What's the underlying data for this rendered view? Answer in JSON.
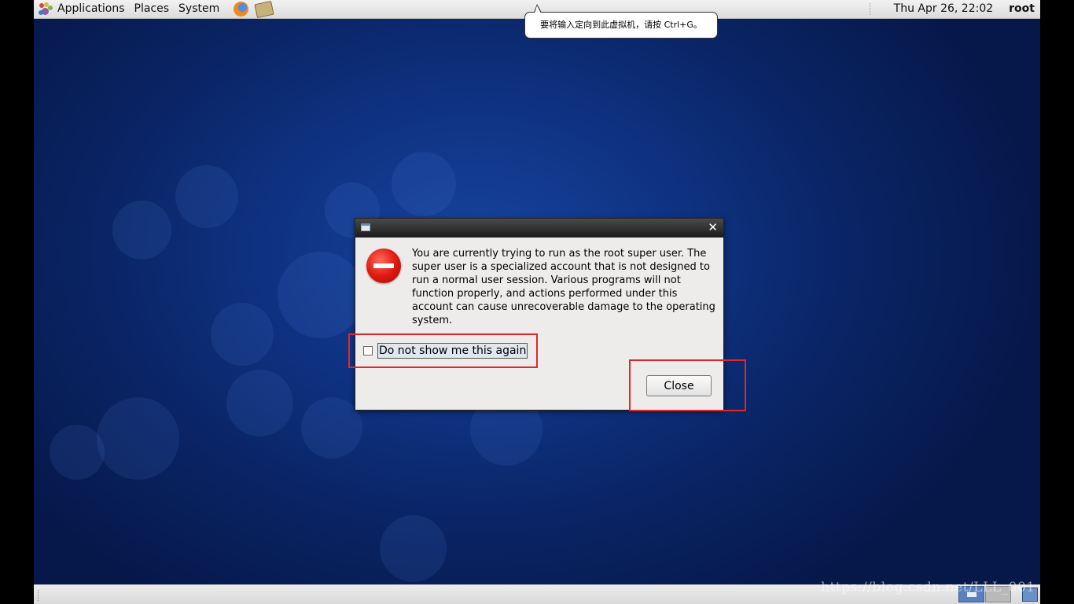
{
  "top_panel": {
    "menus": [
      {
        "label": "Applications",
        "icon": "gnome-foot-icon"
      },
      {
        "label": "Places"
      },
      {
        "label": "System"
      }
    ],
    "launchers": [
      "firefox-icon",
      "text-editor-icon"
    ],
    "clock": "Thu Apr 26, 22:02",
    "user": "root"
  },
  "notice": {
    "text": "要将输入定向到此虚拟机，请按 Ctrl+G。"
  },
  "dialog": {
    "icon": "error-icon",
    "message": "You are currently trying to run as the root super user.  The super user is a specialized account that is not designed to run a normal user session.  Various programs will not function properly, and actions performed under this account can cause unrecoverable damage to the operating system.",
    "checkbox_label": "Do not show me this again",
    "checkbox_checked": false,
    "close_button": "Close"
  },
  "colors": {
    "highlight": "#e0282a",
    "desktop": "#0f3384"
  },
  "watermark": "https://blog.csdn.net/LLL_001"
}
